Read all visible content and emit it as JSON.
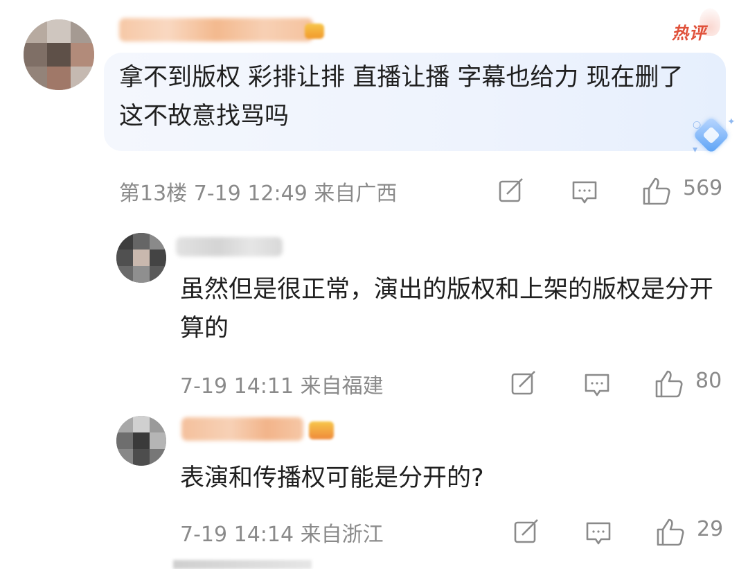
{
  "hot_tag": "热评",
  "comments": [
    {
      "text": "拿不到版权 彩排让排 直播让播  字幕也给力 现在删了 这不故意找骂吗",
      "meta": "第13楼 7-19 12:49 来自广西",
      "likes": "569"
    },
    {
      "text": "虽然但是很正常，演出的版权和上架的版权是分开算的",
      "meta": "7-19 14:11 来自福建",
      "likes": "80"
    },
    {
      "text": "表演和传播权可能是分开的?",
      "meta": "7-19 14:14 来自浙江",
      "likes": "29"
    }
  ],
  "colors": {
    "meta_gray": "#8a8a8a",
    "hot_red": "#e0513a",
    "bubble_blue": "#eef3fd"
  },
  "icons": [
    "edit-icon",
    "comment-icon",
    "like-icon"
  ]
}
